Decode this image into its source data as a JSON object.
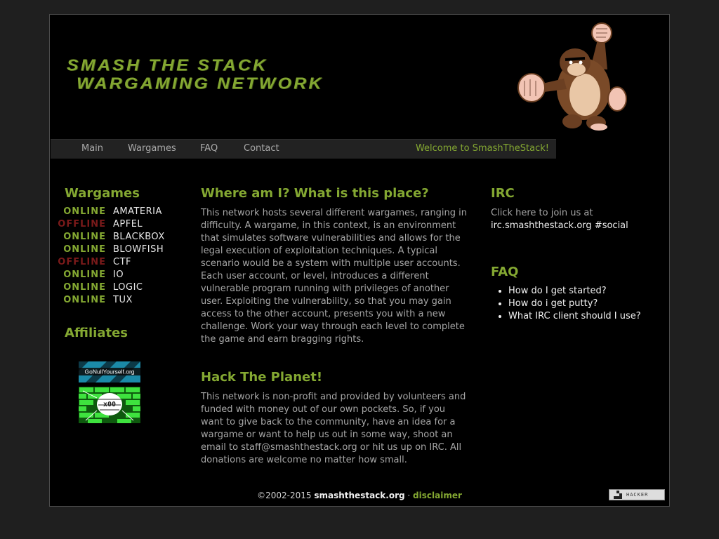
{
  "header": {
    "logo_line1": "Smash The Stack",
    "logo_line2": "Wargaming Network"
  },
  "nav": {
    "items": [
      "Main",
      "Wargames",
      "FAQ",
      "Contact"
    ],
    "welcome": "Welcome to SmashTheStack!"
  },
  "wargames": {
    "title": "Wargames",
    "list": [
      {
        "status": "ONLINE",
        "name": "AMATERIA"
      },
      {
        "status": "OFFLINE",
        "name": "APFEL"
      },
      {
        "status": "ONLINE",
        "name": "BLACKBOX"
      },
      {
        "status": "ONLINE",
        "name": "BLOWFISH"
      },
      {
        "status": "OFFLINE",
        "name": "CTF"
      },
      {
        "status": "ONLINE",
        "name": "IO"
      },
      {
        "status": "ONLINE",
        "name": "LOGIC"
      },
      {
        "status": "ONLINE",
        "name": "TUX"
      }
    ]
  },
  "affiliates": {
    "title": "Affiliates",
    "badge1_text": "GoNullYourself.org",
    "badge2_text": "x00"
  },
  "main": {
    "section1_title": "Where am I? What is this place?",
    "section1_text": "This network hosts several different wargames, ranging in difficulty. A wargame, in this context, is an environment that simulates software vulnerabilities and allows for the legal execution of exploitation techniques. A typical scenario would be a system with multiple user accounts. Each user account, or level, introduces a different vulnerable program running with privileges of another user. Exploiting the vulnerability, so that you may gain access to the other account, presents you with a new challenge. Work your way through each level to complete the game and earn bragging rights.",
    "section2_title": "Hack The Planet!",
    "section2_text": "This network is non-profit and provided by volunteers and funded with money out of our own pockets. So, if you want to give back to the community, have an idea for a wargame or want to help us out in some way, shoot an email to staff@smashthestack.org or hit us up on IRC. All donations are welcome no matter how small."
  },
  "irc": {
    "title": "IRC",
    "intro": "Click here to join us at",
    "link": "irc.smashthestack.org #social"
  },
  "faq": {
    "title": "FAQ",
    "items": [
      "How do I get started?",
      "How do i get putty?",
      "What IRC client should I use?"
    ]
  },
  "footer": {
    "copyright": "©2002-2015 ",
    "site": "smashthestack.org",
    "sep": " · ",
    "disclaimer": "disclaimer"
  },
  "badge": {
    "text": "HACKER"
  },
  "colors": {
    "accent": "#84a832",
    "offline": "#7a1a1a",
    "background": "#000000",
    "page": "#1f1f1f"
  }
}
